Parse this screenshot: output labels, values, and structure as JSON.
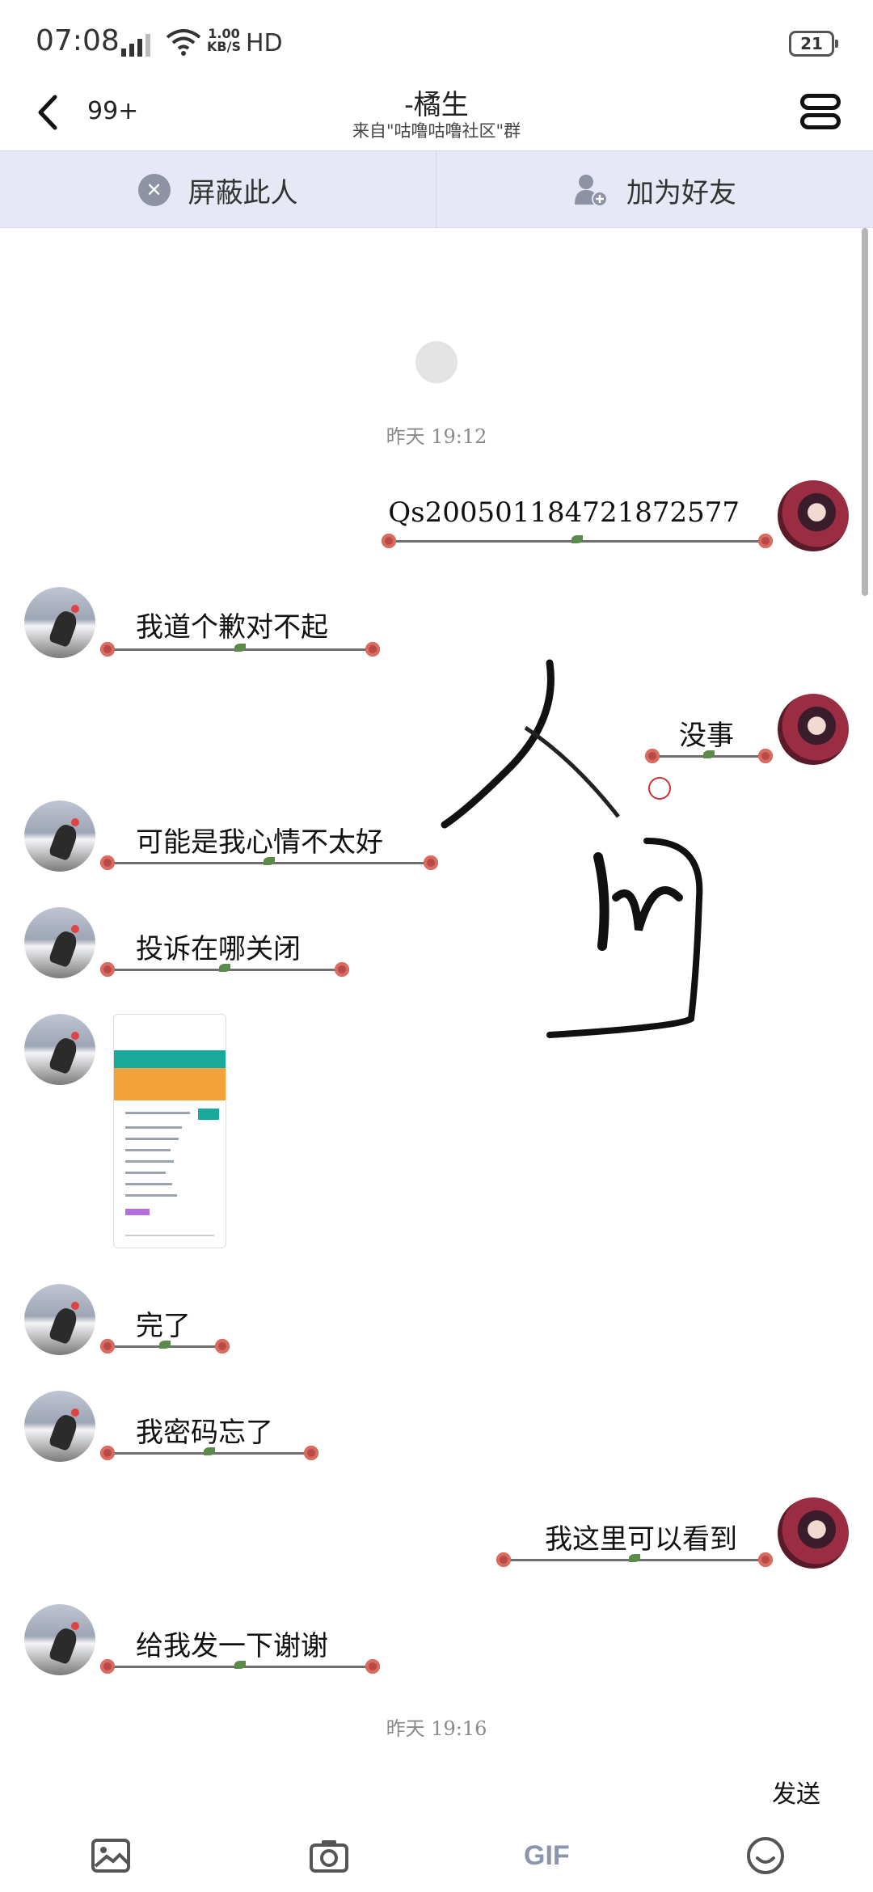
{
  "status_bar": {
    "time": "07:08",
    "network": "4G",
    "speed_value": "1.00",
    "speed_unit": "KB/S",
    "hd": "HD",
    "battery": "21"
  },
  "header": {
    "back_count": "99+",
    "title": "-橘生",
    "subtitle": "来自\"咕噜咕噜社区\"群"
  },
  "actions": {
    "block": "屏蔽此人",
    "add_friend": "加为好友"
  },
  "chat": {
    "timestamp_1": "昨天 19:12",
    "timestamp_2": "昨天 19:16",
    "messages": [
      {
        "side": "right",
        "text": "Qs20050118472187257​7"
      },
      {
        "side": "left",
        "text": "我道个歉对不起"
      },
      {
        "side": "right",
        "text": "没事"
      },
      {
        "side": "left",
        "text": "可能是我心情不太好"
      },
      {
        "side": "left",
        "text": "投诉在哪关闭"
      },
      {
        "side": "left",
        "text": "完了"
      },
      {
        "side": "left",
        "text": "我密码忘了"
      },
      {
        "side": "right",
        "text": "我这里可以看到"
      },
      {
        "side": "left",
        "text": "给我发一下谢谢"
      }
    ]
  },
  "footer": {
    "send": "发送"
  },
  "colors": {
    "action_bar_bg": "#e6e9f5",
    "teal": "#19a99a",
    "orange": "#f2a23a",
    "rose": "#b84a4a"
  }
}
